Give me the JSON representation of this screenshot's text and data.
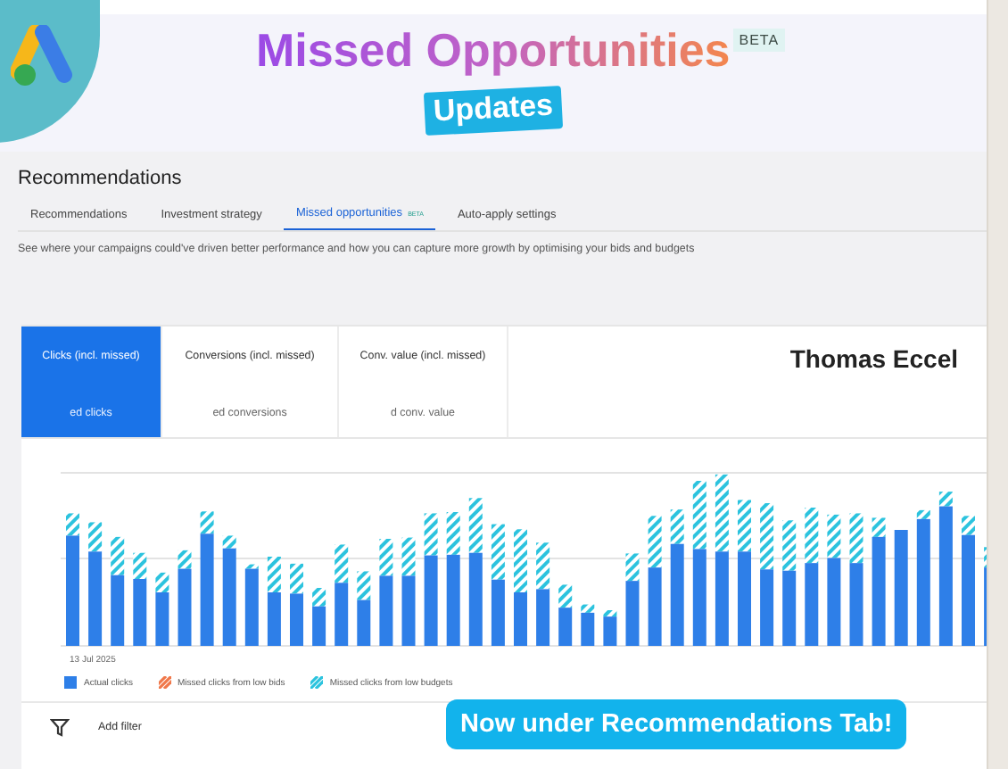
{
  "banner": {
    "title": "Missed Opportunities",
    "badge": "BETA",
    "subtitle": "Updates"
  },
  "page": {
    "heading": "Recommendations",
    "tabs": [
      {
        "label": "Recommendations",
        "selected": false
      },
      {
        "label": "Investment strategy",
        "selected": false
      },
      {
        "label": "Missed opportunities",
        "badge": "BETA",
        "selected": true
      },
      {
        "label": "Auto-apply settings",
        "selected": false
      }
    ],
    "description": "See where your campaigns could've driven better performance and how you can capture more growth by optimising your bids and budgets"
  },
  "metrics": [
    {
      "label": "Clicks (incl. missed)",
      "value": "ed clicks",
      "selected": true
    },
    {
      "label": "Conversions (incl. missed)",
      "value": "ed conversions",
      "selected": false
    },
    {
      "label": "Conv. value (incl. missed)",
      "value": "d conv. value",
      "selected": false
    }
  ],
  "author": "Thomas Eccel",
  "chart": {
    "x_label": "13 Jul 2025",
    "legend": [
      {
        "label": "Actual clicks",
        "kind": "solid",
        "color": "#2e7fe8"
      },
      {
        "label": "Missed clicks from low bids",
        "kind": "hatch",
        "color": "#f0784a"
      },
      {
        "label": "Missed clicks from low budgets",
        "kind": "hatch",
        "color": "#2cc3de"
      }
    ]
  },
  "filter": {
    "label": "Add filter"
  },
  "callout": "Now under Recommendations Tab!"
}
